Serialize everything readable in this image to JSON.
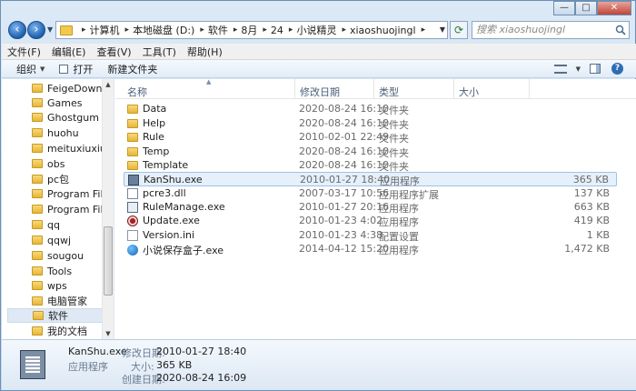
{
  "window": {
    "controls": {
      "minimize": "—",
      "maximize": "□",
      "close": "✕"
    }
  },
  "address": {
    "crumbs": [
      "计算机",
      "本地磁盘 (D:)",
      "软件",
      "8月",
      "24",
      "小说精灵",
      "xiaoshuojingl"
    ],
    "search_placeholder": "搜索 xiaoshuojingl"
  },
  "menubar": {
    "items": [
      "文件(F)",
      "编辑(E)",
      "查看(V)",
      "工具(T)",
      "帮助(H)"
    ]
  },
  "toolbar": {
    "organize_label": "组织",
    "open_label": "打开",
    "new_folder_label": "新建文件夹"
  },
  "nav_pane": {
    "items": [
      {
        "label": "FeigeDownloa",
        "selected": false
      },
      {
        "label": "Games",
        "selected": false
      },
      {
        "label": "Ghostgum",
        "selected": false
      },
      {
        "label": "huohu",
        "selected": false
      },
      {
        "label": "meituxiuxiu",
        "selected": false
      },
      {
        "label": "obs",
        "selected": false
      },
      {
        "label": "pc包",
        "selected": false
      },
      {
        "label": "Program Files",
        "selected": false
      },
      {
        "label": "Program Files",
        "selected": false
      },
      {
        "label": "qq",
        "selected": false
      },
      {
        "label": "qqwj",
        "selected": false
      },
      {
        "label": "sougou",
        "selected": false
      },
      {
        "label": "Tools",
        "selected": false
      },
      {
        "label": "wps",
        "selected": false
      },
      {
        "label": "电脑管家",
        "selected": false
      },
      {
        "label": "软件",
        "selected": true
      },
      {
        "label": "我的文档",
        "selected": false
      }
    ]
  },
  "file_list": {
    "columns": {
      "name": "名称",
      "date": "修改日期",
      "type": "类型",
      "size": "大小"
    },
    "rows": [
      {
        "icon": "folder-icon",
        "name": "Data",
        "date": "2020-08-24 16:10",
        "type": "文件夹",
        "size": ""
      },
      {
        "icon": "folder-icon",
        "name": "Help",
        "date": "2020-08-24 16:10",
        "type": "文件夹",
        "size": ""
      },
      {
        "icon": "folder-icon",
        "name": "Rule",
        "date": "2010-02-01 22:49",
        "type": "文件夹",
        "size": ""
      },
      {
        "icon": "folder-icon",
        "name": "Temp",
        "date": "2020-08-24 16:10",
        "type": "文件夹",
        "size": ""
      },
      {
        "icon": "folder-icon",
        "name": "Template",
        "date": "2020-08-24 16:10",
        "type": "文件夹",
        "size": ""
      },
      {
        "icon": "application-icon",
        "name": "KanShu.exe",
        "date": "2010-01-27 18:40",
        "type": "应用程序",
        "size": "365 KB",
        "selected": true
      },
      {
        "icon": "dll-file-icon",
        "name": "pcre3.dll",
        "date": "2007-03-17 10:56",
        "type": "应用程序扩展",
        "size": "137 KB"
      },
      {
        "icon": "rule-manage-icon",
        "name": "RuleManage.exe",
        "date": "2010-01-27 20:16",
        "type": "应用程序",
        "size": "663 KB"
      },
      {
        "icon": "update-icon",
        "name": "Update.exe",
        "date": "2010-01-23 4:02",
        "type": "应用程序",
        "size": "419 KB"
      },
      {
        "icon": "ini-file-icon",
        "name": "Version.ini",
        "date": "2010-01-23 4:38",
        "type": "配置设置",
        "size": "1 KB"
      },
      {
        "icon": "globe-icon",
        "name": "小说保存盒子.exe",
        "date": "2014-04-12 15:20",
        "type": "应用程序",
        "size": "1,472 KB"
      }
    ]
  },
  "details": {
    "name": "KanShu.exe",
    "type": "应用程序",
    "modified_label": "修改日期:",
    "modified": "2010-01-27 18:40",
    "size_label": "大小:",
    "size": "365 KB",
    "created_label": "创建日期:",
    "created": "2020-08-24 16:09"
  }
}
